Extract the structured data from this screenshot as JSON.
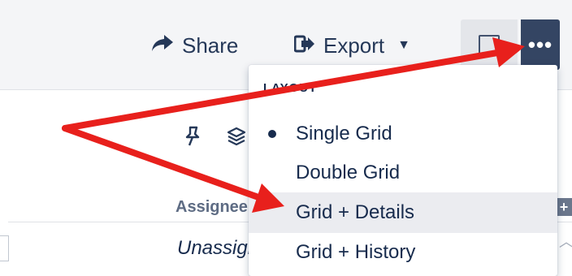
{
  "toolbar": {
    "share_label": "Share",
    "share_icon": "share-arrow-icon",
    "export_label": "Export",
    "export_icon": "export-icon",
    "export_caret": "▼",
    "more_label": "•••"
  },
  "content": {
    "column_header": "Assignee",
    "cell_value": "Unassigned"
  },
  "menu": {
    "heading": "LAYOUT",
    "items": [
      {
        "label": "Single Grid",
        "selected": true
      },
      {
        "label": "Double Grid",
        "selected": false
      },
      {
        "label": "Grid + Details",
        "selected": false,
        "highlighted": true
      },
      {
        "label": "Grid + History",
        "selected": false
      }
    ]
  },
  "colors": {
    "annotation_arrow": "#e8201c",
    "more_button_bg": "#344563",
    "highlight_bg": "#ebecf0"
  }
}
